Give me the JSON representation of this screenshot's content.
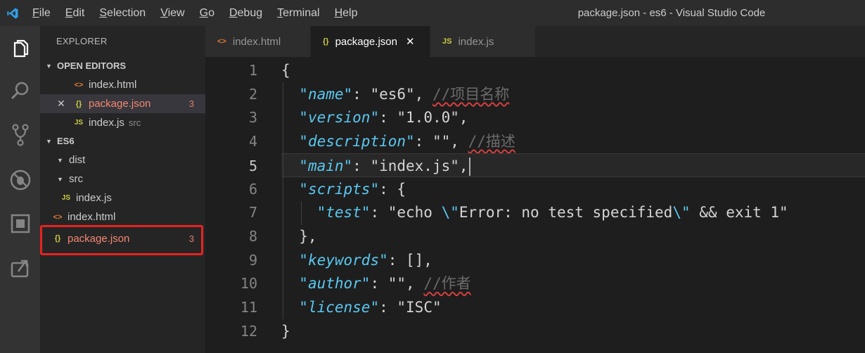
{
  "window": {
    "title": "package.json - es6 - Visual Studio Code"
  },
  "menu": [
    {
      "label": "File",
      "mnemonic": "F",
      "rest": "ile"
    },
    {
      "label": "Edit",
      "mnemonic": "E",
      "rest": "dit"
    },
    {
      "label": "Selection",
      "mnemonic": "S",
      "rest": "election"
    },
    {
      "label": "View",
      "mnemonic": "V",
      "rest": "iew"
    },
    {
      "label": "Go",
      "mnemonic": "G",
      "rest": "o"
    },
    {
      "label": "Debug",
      "mnemonic": "D",
      "rest": "ebug"
    },
    {
      "label": "Terminal",
      "mnemonic": "T",
      "rest": "erminal"
    },
    {
      "label": "Help",
      "mnemonic": "H",
      "rest": "elp"
    }
  ],
  "activity_icons": [
    "explorer-icon",
    "search-icon",
    "source-control-icon",
    "debug-icon",
    "extensions-icon",
    "remote-icon"
  ],
  "sidebar": {
    "title": "EXPLORER",
    "open_editors_label": "OPEN EDITORS",
    "open_editors": [
      {
        "icon": "<>",
        "name": "index.html",
        "desc": "",
        "count": ""
      },
      {
        "icon": "{}",
        "name": "package.json",
        "desc": "",
        "count": "3"
      },
      {
        "icon": "JS",
        "name": "index.js",
        "desc": "src",
        "count": ""
      }
    ],
    "close_glyph": "✕",
    "folder_label": "ES6",
    "tree": [
      {
        "name": "dist",
        "type": "folder"
      },
      {
        "name": "src",
        "type": "folder"
      },
      {
        "icon": "JS",
        "name": "index.js"
      },
      {
        "icon": "<>",
        "name": "index.html"
      },
      {
        "icon": "{}",
        "name": "package.json",
        "count": "3"
      }
    ]
  },
  "tabs": [
    {
      "icon": "<>",
      "label": "index.html",
      "active": false
    },
    {
      "icon": "{}",
      "label": "package.json",
      "active": true,
      "close": "✕"
    },
    {
      "icon": "JS",
      "label": "index.js",
      "active": false
    }
  ],
  "editor": {
    "current_line": 5,
    "lines": [
      {
        "n": "1",
        "tokens": [
          [
            "p",
            "{"
          ]
        ]
      },
      {
        "n": "2",
        "tokens": [
          [
            "p",
            "  "
          ],
          [
            "k",
            "\"name\""
          ],
          [
            "p",
            ": "
          ],
          [
            "s",
            "\"es6\""
          ],
          [
            "p",
            ", "
          ],
          [
            "c",
            "//项目名称"
          ]
        ]
      },
      {
        "n": "3",
        "tokens": [
          [
            "p",
            "  "
          ],
          [
            "k",
            "\"version\""
          ],
          [
            "p",
            ": "
          ],
          [
            "s",
            "\"1.0.0\""
          ],
          [
            "p",
            ","
          ]
        ]
      },
      {
        "n": "4",
        "tokens": [
          [
            "p",
            "  "
          ],
          [
            "k",
            "\"description\""
          ],
          [
            "p",
            ": "
          ],
          [
            "s",
            "\"\""
          ],
          [
            "p",
            ", "
          ],
          [
            "c",
            "//描述"
          ]
        ]
      },
      {
        "n": "5",
        "tokens": [
          [
            "p",
            "  "
          ],
          [
            "k",
            "\"main\""
          ],
          [
            "p",
            ": "
          ],
          [
            "s",
            "\"index.js\""
          ],
          [
            "p",
            ","
          ]
        ]
      },
      {
        "n": "6",
        "tokens": [
          [
            "p",
            "  "
          ],
          [
            "k",
            "\"scripts\""
          ],
          [
            "p",
            ": {"
          ]
        ]
      },
      {
        "n": "7",
        "tokens": [
          [
            "p",
            "    "
          ],
          [
            "k",
            "\"test\""
          ],
          [
            "p",
            ": "
          ],
          [
            "s",
            "\"echo "
          ],
          [
            "e",
            "\\\""
          ],
          [
            "s",
            "Error: no test specified"
          ],
          [
            "e",
            "\\\""
          ],
          [
            "s",
            " && exit 1\""
          ]
        ]
      },
      {
        "n": "8",
        "tokens": [
          [
            "p",
            "  },"
          ]
        ]
      },
      {
        "n": "9",
        "tokens": [
          [
            "p",
            "  "
          ],
          [
            "k",
            "\"keywords\""
          ],
          [
            "p",
            ": [],"
          ]
        ]
      },
      {
        "n": "10",
        "tokens": [
          [
            "p",
            "  "
          ],
          [
            "k",
            "\"author\""
          ],
          [
            "p",
            ": "
          ],
          [
            "s",
            "\"\""
          ],
          [
            "p",
            ", "
          ],
          [
            "c",
            "//作者"
          ]
        ]
      },
      {
        "n": "11",
        "tokens": [
          [
            "p",
            "  "
          ],
          [
            "k",
            "\"license\""
          ],
          [
            "p",
            ": "
          ],
          [
            "s",
            "\"ISC\""
          ]
        ]
      },
      {
        "n": "12",
        "tokens": [
          [
            "p",
            "}"
          ]
        ]
      }
    ]
  },
  "colors": {
    "accent": "#007acc",
    "highlight_box": "#e8231f",
    "error_text": "#f48771",
    "json_key": "#5ac8f0"
  }
}
